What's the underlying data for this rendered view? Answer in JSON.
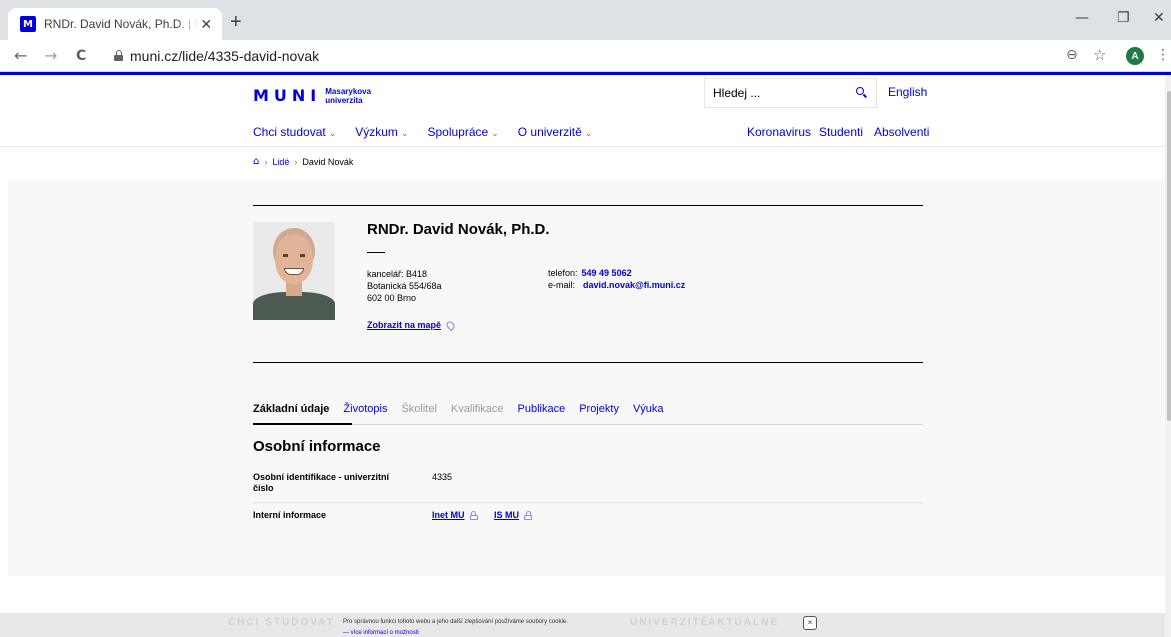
{
  "browser": {
    "tab_title": "RNDr. David Novák, Ph.D. | Masarykova univerzita",
    "favicon_letter": "M",
    "tab_close": "✕",
    "new_tab": "+",
    "url": "muni.cz/lide/4335-david-novak",
    "profile_initial": "A",
    "minimize": "—",
    "restore": "❐",
    "close": "✕",
    "back": "←",
    "forward": "→",
    "reload": "C",
    "zoom": "⊖",
    "star": "☆",
    "menu": "⋮"
  },
  "header": {
    "logo_mark": "MUNI",
    "logo_line1": "Masarykova",
    "logo_line2": "univerzita",
    "search_placeholder": "Hledej ...",
    "language": "English"
  },
  "mainnav": {
    "items": [
      {
        "label": "Chci studovat"
      },
      {
        "label": "Výzkum"
      },
      {
        "label": "Spolupráce"
      },
      {
        "label": "O univerzitě"
      }
    ],
    "chevron": "⌄",
    "right": [
      "Koronavirus",
      "Studenti",
      "Absolventi"
    ]
  },
  "breadcrumb": {
    "home": "⌂",
    "sep": "›",
    "items": [
      "Lidé",
      "David Novák"
    ]
  },
  "person": {
    "name": "RNDr. David Novák, Ph.D.",
    "office": "kancelář: B418",
    "street": "Botanická 554/68a",
    "city": "602 00 Brno",
    "phone_label": "telefon:",
    "phone": "549 49 5062",
    "email_label": "e-mail:",
    "email": "david.novak@fi.muni.cz",
    "map_link": "Zobrazit na mapě"
  },
  "tabs": [
    {
      "label": "Základní údaje",
      "state": "active"
    },
    {
      "label": "Životopis",
      "state": "link"
    },
    {
      "label": "Školitel",
      "state": "muted"
    },
    {
      "label": "Kvalifikace",
      "state": "muted"
    },
    {
      "label": "Publikace",
      "state": "link"
    },
    {
      "label": "Projekty",
      "state": "link"
    },
    {
      "label": "Výuka",
      "state": "link"
    }
  ],
  "personal_info": {
    "title": "Osobní informace",
    "id_label": "Osobní identifikace - univerzitní číslo",
    "id_value": "4335",
    "internal_label": "Interní informace",
    "inet_link": "Inet MU",
    "is_link": "IS MU"
  },
  "cookie": {
    "faded_left": "CHCI STUDOVAT",
    "faded_mid": "UNIVERZITĚ",
    "faded_right": "AKTUALNE",
    "text": "Pro správnou funkci tohoto webu a jeho další zlepšování používáme soubory cookie.",
    "more": "— více informací o možnosti",
    "close": "×"
  },
  "colors": {
    "brand_blue": "#0000dc",
    "page_gray": "#f8f8f8"
  }
}
